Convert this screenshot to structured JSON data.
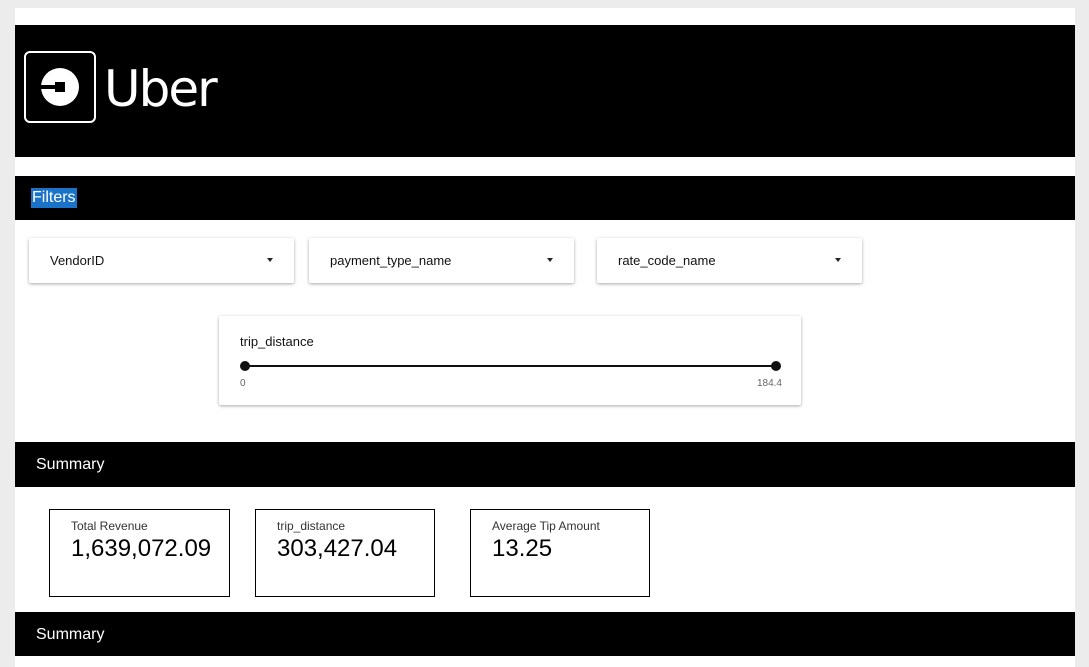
{
  "brand": {
    "name": "Uber"
  },
  "filters": {
    "title": "Filters",
    "dropdowns": [
      {
        "label": "VendorID"
      },
      {
        "label": "payment_type_name"
      },
      {
        "label": "rate_code_name"
      }
    ],
    "slider": {
      "label": "trip_distance",
      "min_label": "0",
      "max_label": "184.4",
      "low_fraction": 0,
      "high_fraction": 1
    }
  },
  "summary": {
    "title": "Summary",
    "cards": [
      {
        "label": "Total Revenue",
        "value": "1,639,072.09"
      },
      {
        "label": "trip_distance",
        "value": "303,427.04"
      },
      {
        "label": "Average Tip Amount",
        "value": "13.25"
      }
    ]
  },
  "summary2": {
    "title": "Summary"
  },
  "colors": {
    "header_bg": "#000000",
    "selection": "#1a73c8",
    "background": "#ececec"
  },
  "icons": {
    "logo": "uber-logo-icon",
    "caret": "caret-down-icon"
  }
}
